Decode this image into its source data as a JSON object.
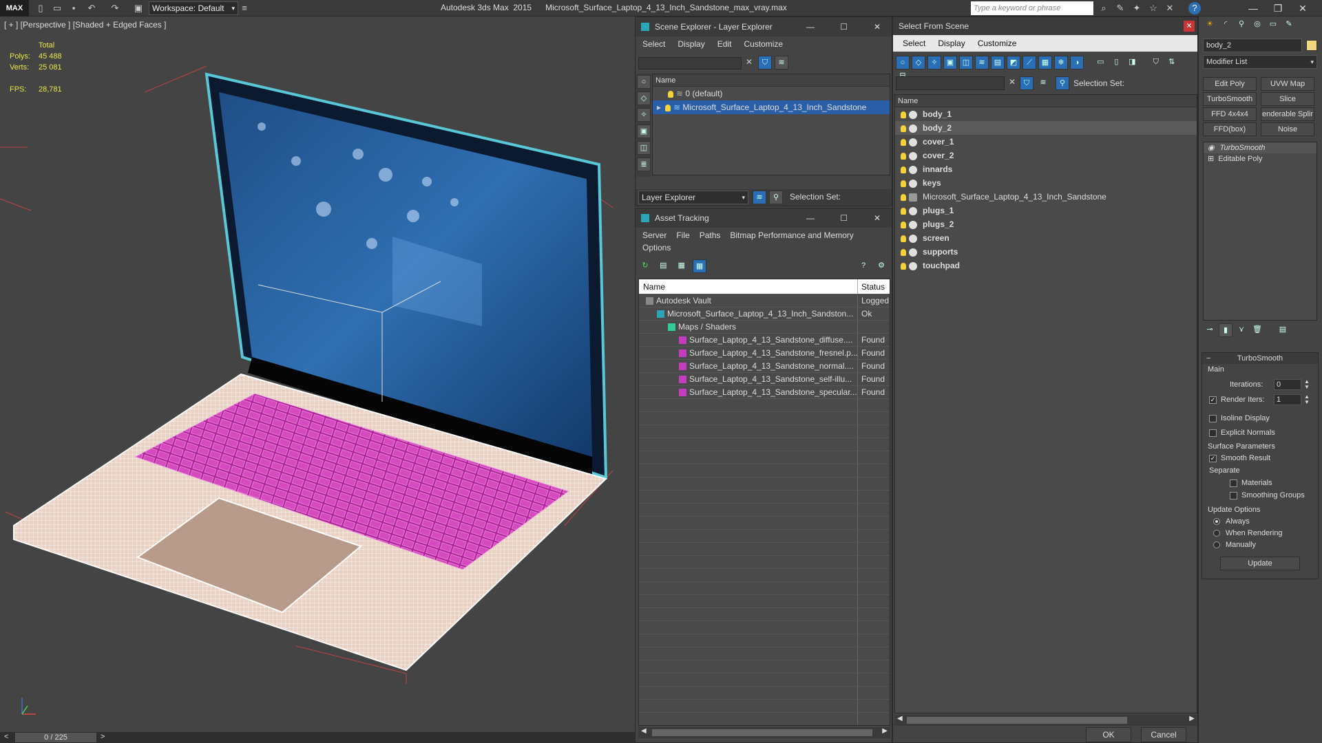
{
  "titlebar": {
    "logo": "MAX",
    "workspace": "Workspace: Default",
    "app_title": "Autodesk 3ds Max  2015      Microsoft_Surface_Laptop_4_13_Inch_Sandstone_max_vray.max",
    "search_placeholder": "Type a keyword or phrase",
    "help": "?"
  },
  "viewport": {
    "label": "[ + ] [Perspective ] [Shaded + Edged Faces ]",
    "stats_header": "Total",
    "polys_label": "Polys:",
    "polys_value": "45 488",
    "verts_label": "Verts:",
    "verts_value": "25 081",
    "fps_label": "FPS:",
    "fps_value": "28,781"
  },
  "timeline": {
    "frame": "0 / 225"
  },
  "scene_explorer": {
    "title": "Scene Explorer - Layer Explorer",
    "menu": [
      "Select",
      "Display",
      "Edit",
      "Customize"
    ],
    "column_name": "Name",
    "rows": [
      "0 (default)",
      "Microsoft_Surface_Laptop_4_13_Inch_Sandstone"
    ],
    "explorer_mode": "Layer Explorer",
    "selection_set_label": "Selection Set:"
  },
  "asset_tracking": {
    "title": "Asset Tracking",
    "menu": [
      "Server",
      "File",
      "Paths",
      "Bitmap Performance and Memory"
    ],
    "menu2": "Options",
    "col_name": "Name",
    "col_status": "Status",
    "rows": [
      {
        "name": "Autodesk Vault",
        "status": "Logged",
        "indent": 0
      },
      {
        "name": "Microsoft_Surface_Laptop_4_13_Inch_Sandston...",
        "status": "Ok",
        "indent": 1
      },
      {
        "name": "Maps / Shaders",
        "status": "",
        "indent": 2
      },
      {
        "name": "Surface_Laptop_4_13_Sandstone_diffuse....",
        "status": "Found",
        "indent": 3
      },
      {
        "name": "Surface_Laptop_4_13_Sandstone_fresnel.p...",
        "status": "Found",
        "indent": 3
      },
      {
        "name": "Surface_Laptop_4_13_Sandstone_normal....",
        "status": "Found",
        "indent": 3
      },
      {
        "name": "Surface_Laptop_4_13_Sandstone_self-illu...",
        "status": "Found",
        "indent": 3
      },
      {
        "name": "Surface_Laptop_4_13_Sandstone_specular...",
        "status": "Found",
        "indent": 3
      }
    ]
  },
  "select_from_scene": {
    "title": "Select From Scene",
    "menu": [
      "Select",
      "Display",
      "Customize"
    ],
    "selection_set_label": "Selection Set:",
    "column_name": "Name",
    "objects": [
      {
        "name": "body_1",
        "bold": true
      },
      {
        "name": "body_2",
        "bold": true
      },
      {
        "name": "cover_1",
        "bold": true
      },
      {
        "name": "cover_2",
        "bold": true
      },
      {
        "name": "innards",
        "bold": true
      },
      {
        "name": "keys",
        "bold": true
      },
      {
        "name": "Microsoft_Surface_Laptop_4_13_Inch_Sandstone",
        "bold": false
      },
      {
        "name": "plugs_1",
        "bold": true
      },
      {
        "name": "plugs_2",
        "bold": true
      },
      {
        "name": "screen",
        "bold": true
      },
      {
        "name": "supports",
        "bold": true
      },
      {
        "name": "touchpad",
        "bold": true
      }
    ],
    "ok": "OK",
    "cancel": "Cancel"
  },
  "command_panel": {
    "object_name": "body_2",
    "modifier_list": "Modifier List",
    "buttons": [
      "Edit Poly",
      "UVW Map",
      "TurboSmooth",
      "Slice",
      "FFD 4x4x4",
      "enderable Splir",
      "FFD(box)",
      "Noise"
    ],
    "stack": [
      "TurboSmooth",
      "Editable Poly"
    ],
    "rollout_title": "TurboSmooth",
    "main_label": "Main",
    "iterations_label": "Iterations:",
    "iterations_value": "0",
    "render_iters_label": "Render Iters:",
    "render_iters_value": "1",
    "isoline": "Isoline Display",
    "explicit_normals": "Explicit Normals",
    "surface_params": "Surface Parameters",
    "smooth_result": "Smooth Result",
    "separate": "Separate",
    "materials": "Materials",
    "smoothing_groups": "Smoothing Groups",
    "update_options": "Update Options",
    "always": "Always",
    "when_rendering": "When Rendering",
    "manually": "Manually",
    "update_button": "Update"
  }
}
